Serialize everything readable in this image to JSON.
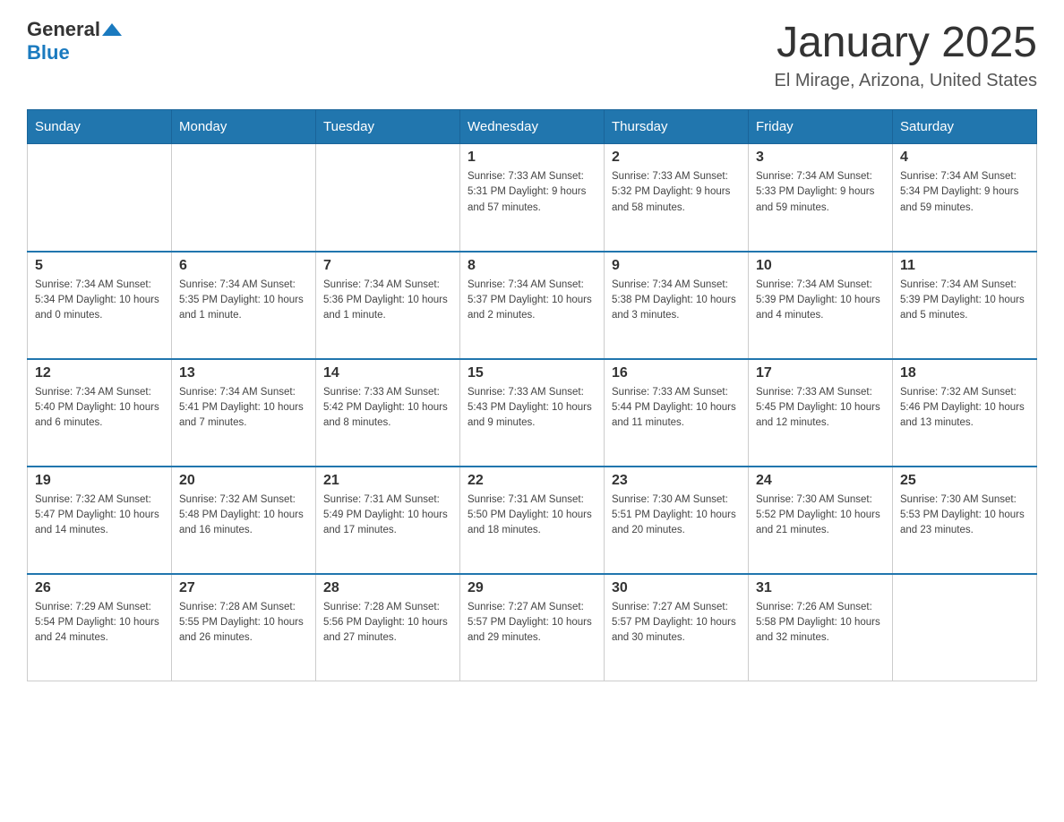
{
  "header": {
    "logo": {
      "text_general": "General",
      "text_blue": "Blue",
      "arrow": "▲"
    },
    "title": "January 2025",
    "subtitle": "El Mirage, Arizona, United States"
  },
  "days_of_week": [
    "Sunday",
    "Monday",
    "Tuesday",
    "Wednesday",
    "Thursday",
    "Friday",
    "Saturday"
  ],
  "weeks": [
    {
      "days": [
        {
          "number": "",
          "info": ""
        },
        {
          "number": "",
          "info": ""
        },
        {
          "number": "",
          "info": ""
        },
        {
          "number": "1",
          "info": "Sunrise: 7:33 AM\nSunset: 5:31 PM\nDaylight: 9 hours\nand 57 minutes."
        },
        {
          "number": "2",
          "info": "Sunrise: 7:33 AM\nSunset: 5:32 PM\nDaylight: 9 hours\nand 58 minutes."
        },
        {
          "number": "3",
          "info": "Sunrise: 7:34 AM\nSunset: 5:33 PM\nDaylight: 9 hours\nand 59 minutes."
        },
        {
          "number": "4",
          "info": "Sunrise: 7:34 AM\nSunset: 5:34 PM\nDaylight: 9 hours\nand 59 minutes."
        }
      ]
    },
    {
      "days": [
        {
          "number": "5",
          "info": "Sunrise: 7:34 AM\nSunset: 5:34 PM\nDaylight: 10 hours\nand 0 minutes."
        },
        {
          "number": "6",
          "info": "Sunrise: 7:34 AM\nSunset: 5:35 PM\nDaylight: 10 hours\nand 1 minute."
        },
        {
          "number": "7",
          "info": "Sunrise: 7:34 AM\nSunset: 5:36 PM\nDaylight: 10 hours\nand 1 minute."
        },
        {
          "number": "8",
          "info": "Sunrise: 7:34 AM\nSunset: 5:37 PM\nDaylight: 10 hours\nand 2 minutes."
        },
        {
          "number": "9",
          "info": "Sunrise: 7:34 AM\nSunset: 5:38 PM\nDaylight: 10 hours\nand 3 minutes."
        },
        {
          "number": "10",
          "info": "Sunrise: 7:34 AM\nSunset: 5:39 PM\nDaylight: 10 hours\nand 4 minutes."
        },
        {
          "number": "11",
          "info": "Sunrise: 7:34 AM\nSunset: 5:39 PM\nDaylight: 10 hours\nand 5 minutes."
        }
      ]
    },
    {
      "days": [
        {
          "number": "12",
          "info": "Sunrise: 7:34 AM\nSunset: 5:40 PM\nDaylight: 10 hours\nand 6 minutes."
        },
        {
          "number": "13",
          "info": "Sunrise: 7:34 AM\nSunset: 5:41 PM\nDaylight: 10 hours\nand 7 minutes."
        },
        {
          "number": "14",
          "info": "Sunrise: 7:33 AM\nSunset: 5:42 PM\nDaylight: 10 hours\nand 8 minutes."
        },
        {
          "number": "15",
          "info": "Sunrise: 7:33 AM\nSunset: 5:43 PM\nDaylight: 10 hours\nand 9 minutes."
        },
        {
          "number": "16",
          "info": "Sunrise: 7:33 AM\nSunset: 5:44 PM\nDaylight: 10 hours\nand 11 minutes."
        },
        {
          "number": "17",
          "info": "Sunrise: 7:33 AM\nSunset: 5:45 PM\nDaylight: 10 hours\nand 12 minutes."
        },
        {
          "number": "18",
          "info": "Sunrise: 7:32 AM\nSunset: 5:46 PM\nDaylight: 10 hours\nand 13 minutes."
        }
      ]
    },
    {
      "days": [
        {
          "number": "19",
          "info": "Sunrise: 7:32 AM\nSunset: 5:47 PM\nDaylight: 10 hours\nand 14 minutes."
        },
        {
          "number": "20",
          "info": "Sunrise: 7:32 AM\nSunset: 5:48 PM\nDaylight: 10 hours\nand 16 minutes."
        },
        {
          "number": "21",
          "info": "Sunrise: 7:31 AM\nSunset: 5:49 PM\nDaylight: 10 hours\nand 17 minutes."
        },
        {
          "number": "22",
          "info": "Sunrise: 7:31 AM\nSunset: 5:50 PM\nDaylight: 10 hours\nand 18 minutes."
        },
        {
          "number": "23",
          "info": "Sunrise: 7:30 AM\nSunset: 5:51 PM\nDaylight: 10 hours\nand 20 minutes."
        },
        {
          "number": "24",
          "info": "Sunrise: 7:30 AM\nSunset: 5:52 PM\nDaylight: 10 hours\nand 21 minutes."
        },
        {
          "number": "25",
          "info": "Sunrise: 7:30 AM\nSunset: 5:53 PM\nDaylight: 10 hours\nand 23 minutes."
        }
      ]
    },
    {
      "days": [
        {
          "number": "26",
          "info": "Sunrise: 7:29 AM\nSunset: 5:54 PM\nDaylight: 10 hours\nand 24 minutes."
        },
        {
          "number": "27",
          "info": "Sunrise: 7:28 AM\nSunset: 5:55 PM\nDaylight: 10 hours\nand 26 minutes."
        },
        {
          "number": "28",
          "info": "Sunrise: 7:28 AM\nSunset: 5:56 PM\nDaylight: 10 hours\nand 27 minutes."
        },
        {
          "number": "29",
          "info": "Sunrise: 7:27 AM\nSunset: 5:57 PM\nDaylight: 10 hours\nand 29 minutes."
        },
        {
          "number": "30",
          "info": "Sunrise: 7:27 AM\nSunset: 5:57 PM\nDaylight: 10 hours\nand 30 minutes."
        },
        {
          "number": "31",
          "info": "Sunrise: 7:26 AM\nSunset: 5:58 PM\nDaylight: 10 hours\nand 32 minutes."
        },
        {
          "number": "",
          "info": ""
        }
      ]
    }
  ]
}
